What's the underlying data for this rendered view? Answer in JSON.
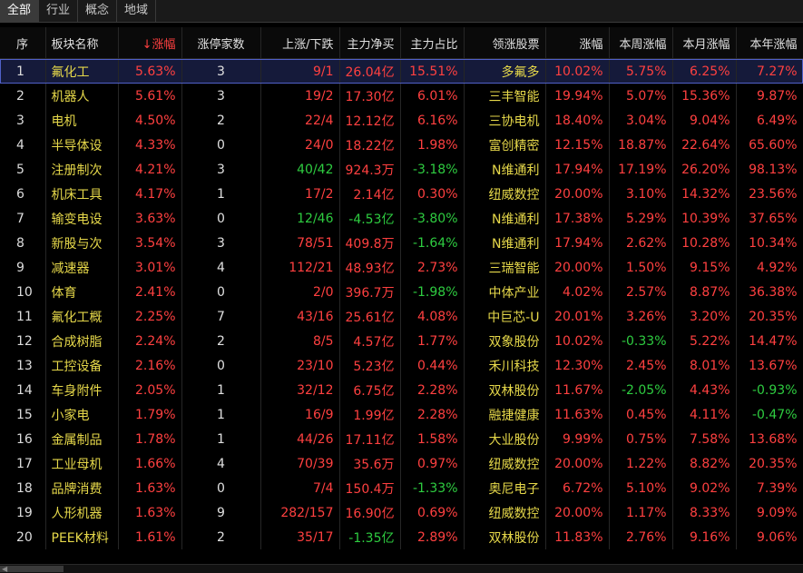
{
  "tabs": [
    "全部",
    "行业",
    "概念",
    "地域"
  ],
  "headers": {
    "seq": "序",
    "name": "板块名称",
    "change": "↓涨幅",
    "limit_up_count": "涨停家数",
    "up_down": "上涨/下跌",
    "main_net": "主力净买",
    "main_ratio": "主力占比",
    "lead_stock": "领涨股票",
    "lead_change": "涨幅",
    "week_change": "本周涨幅",
    "month_change": "本月涨幅",
    "year_change": "本年涨幅"
  },
  "rows": [
    {
      "seq": "1",
      "name": "氟化工",
      "change": "5.63%",
      "limit": "3",
      "updown": "9/1",
      "net": "26.04亿",
      "ratio": "15.51%",
      "stock": "多氟多",
      "lchg": "10.02%",
      "week": "5.75%",
      "month": "6.25%",
      "year": "7.27%"
    },
    {
      "seq": "2",
      "name": "机器人",
      "change": "5.61%",
      "limit": "3",
      "updown": "19/2",
      "net": "17.30亿",
      "ratio": "6.01%",
      "stock": "三丰智能",
      "lchg": "19.94%",
      "week": "5.07%",
      "month": "15.36%",
      "year": "9.87%"
    },
    {
      "seq": "3",
      "name": "电机",
      "change": "4.50%",
      "limit": "2",
      "updown": "22/4",
      "net": "12.12亿",
      "ratio": "6.16%",
      "stock": "三协电机",
      "lchg": "18.40%",
      "week": "3.04%",
      "month": "9.04%",
      "year": "6.49%"
    },
    {
      "seq": "4",
      "name": "半导体设",
      "change": "4.33%",
      "limit": "0",
      "updown": "24/0",
      "net": "18.22亿",
      "ratio": "1.98%",
      "stock": "富创精密",
      "lchg": "12.15%",
      "week": "18.87%",
      "month": "22.64%",
      "year": "65.60%"
    },
    {
      "seq": "5",
      "name": "注册制次",
      "change": "4.21%",
      "limit": "3",
      "updown": "40/42",
      "net": "924.3万",
      "ratio": "-3.18%",
      "stock": "N维通利",
      "lchg": "17.94%",
      "week": "17.19%",
      "month": "26.20%",
      "year": "98.13%"
    },
    {
      "seq": "6",
      "name": "机床工具",
      "change": "4.17%",
      "limit": "1",
      "updown": "17/2",
      "net": "2.14亿",
      "ratio": "0.30%",
      "stock": "纽威数控",
      "lchg": "20.00%",
      "week": "3.10%",
      "month": "14.32%",
      "year": "23.56%"
    },
    {
      "seq": "7",
      "name": "输变电设",
      "change": "3.63%",
      "limit": "0",
      "updown": "12/46",
      "net": "-4.53亿",
      "ratio": "-3.80%",
      "stock": "N维通利",
      "lchg": "17.38%",
      "week": "5.29%",
      "month": "10.39%",
      "year": "37.65%"
    },
    {
      "seq": "8",
      "name": "新股与次",
      "change": "3.54%",
      "limit": "3",
      "updown": "78/51",
      "net": "409.8万",
      "ratio": "-1.64%",
      "stock": "N维通利",
      "lchg": "17.94%",
      "week": "2.62%",
      "month": "10.28%",
      "year": "10.34%"
    },
    {
      "seq": "9",
      "name": "减速器",
      "change": "3.01%",
      "limit": "4",
      "updown": "112/21",
      "net": "48.93亿",
      "ratio": "2.73%",
      "stock": "三瑞智能",
      "lchg": "20.00%",
      "week": "1.50%",
      "month": "9.15%",
      "year": "4.92%"
    },
    {
      "seq": "10",
      "name": "体育",
      "change": "2.41%",
      "limit": "0",
      "updown": "2/0",
      "net": "396.7万",
      "ratio": "-1.98%",
      "stock": "中体产业",
      "lchg": "4.02%",
      "week": "2.57%",
      "month": "8.87%",
      "year": "36.38%"
    },
    {
      "seq": "11",
      "name": "氟化工概",
      "change": "2.25%",
      "limit": "7",
      "updown": "43/16",
      "net": "25.61亿",
      "ratio": "4.08%",
      "stock": "中巨芯-U",
      "lchg": "20.01%",
      "week": "3.26%",
      "month": "3.20%",
      "year": "20.35%"
    },
    {
      "seq": "12",
      "name": "合成树脂",
      "change": "2.24%",
      "limit": "2",
      "updown": "8/5",
      "net": "4.57亿",
      "ratio": "1.77%",
      "stock": "双象股份",
      "lchg": "10.02%",
      "week": "-0.33%",
      "month": "5.22%",
      "year": "14.47%"
    },
    {
      "seq": "13",
      "name": "工控设备",
      "change": "2.16%",
      "limit": "0",
      "updown": "23/10",
      "net": "5.23亿",
      "ratio": "0.44%",
      "stock": "禾川科技",
      "lchg": "12.30%",
      "week": "2.45%",
      "month": "8.01%",
      "year": "13.67%"
    },
    {
      "seq": "14",
      "name": "车身附件",
      "change": "2.05%",
      "limit": "1",
      "updown": "32/12",
      "net": "6.75亿",
      "ratio": "2.28%",
      "stock": "双林股份",
      "lchg": "11.67%",
      "week": "-2.05%",
      "month": "4.43%",
      "year": "-0.93%"
    },
    {
      "seq": "15",
      "name": "小家电",
      "change": "1.79%",
      "limit": "1",
      "updown": "16/9",
      "net": "1.99亿",
      "ratio": "2.28%",
      "stock": "融捷健康",
      "lchg": "11.63%",
      "week": "0.45%",
      "month": "4.11%",
      "year": "-0.47%"
    },
    {
      "seq": "16",
      "name": "金属制品",
      "change": "1.78%",
      "limit": "1",
      "updown": "44/26",
      "net": "17.11亿",
      "ratio": "1.58%",
      "stock": "大业股份",
      "lchg": "9.99%",
      "week": "0.75%",
      "month": "7.58%",
      "year": "13.68%"
    },
    {
      "seq": "17",
      "name": "工业母机",
      "change": "1.66%",
      "limit": "4",
      "updown": "70/39",
      "net": "35.6万",
      "ratio": "0.97%",
      "stock": "纽威数控",
      "lchg": "20.00%",
      "week": "1.22%",
      "month": "8.82%",
      "year": "20.35%"
    },
    {
      "seq": "18",
      "name": "品牌消费",
      "change": "1.63%",
      "limit": "0",
      "updown": "7/4",
      "net": "150.4万",
      "ratio": "-1.33%",
      "stock": "奥尼电子",
      "lchg": "6.72%",
      "week": "5.10%",
      "month": "9.02%",
      "year": "7.39%"
    },
    {
      "seq": "19",
      "name": "人形机器",
      "change": "1.63%",
      "limit": "9",
      "updown": "282/157",
      "net": "16.90亿",
      "ratio": "0.69%",
      "stock": "纽威数控",
      "lchg": "20.00%",
      "week": "1.17%",
      "month": "8.33%",
      "year": "9.09%"
    },
    {
      "seq": "20",
      "name": "PEEK材料",
      "change": "1.61%",
      "limit": "2",
      "updown": "35/17",
      "net": "-1.35亿",
      "ratio": "2.89%",
      "stock": "双林股份",
      "lchg": "11.83%",
      "week": "2.76%",
      "month": "9.16%",
      "year": "9.06%"
    }
  ],
  "colors": {
    "up": "#ff4040",
    "down": "#2ecc40",
    "name": "#e6d84a",
    "selected_row_bg": "#151a3a"
  }
}
